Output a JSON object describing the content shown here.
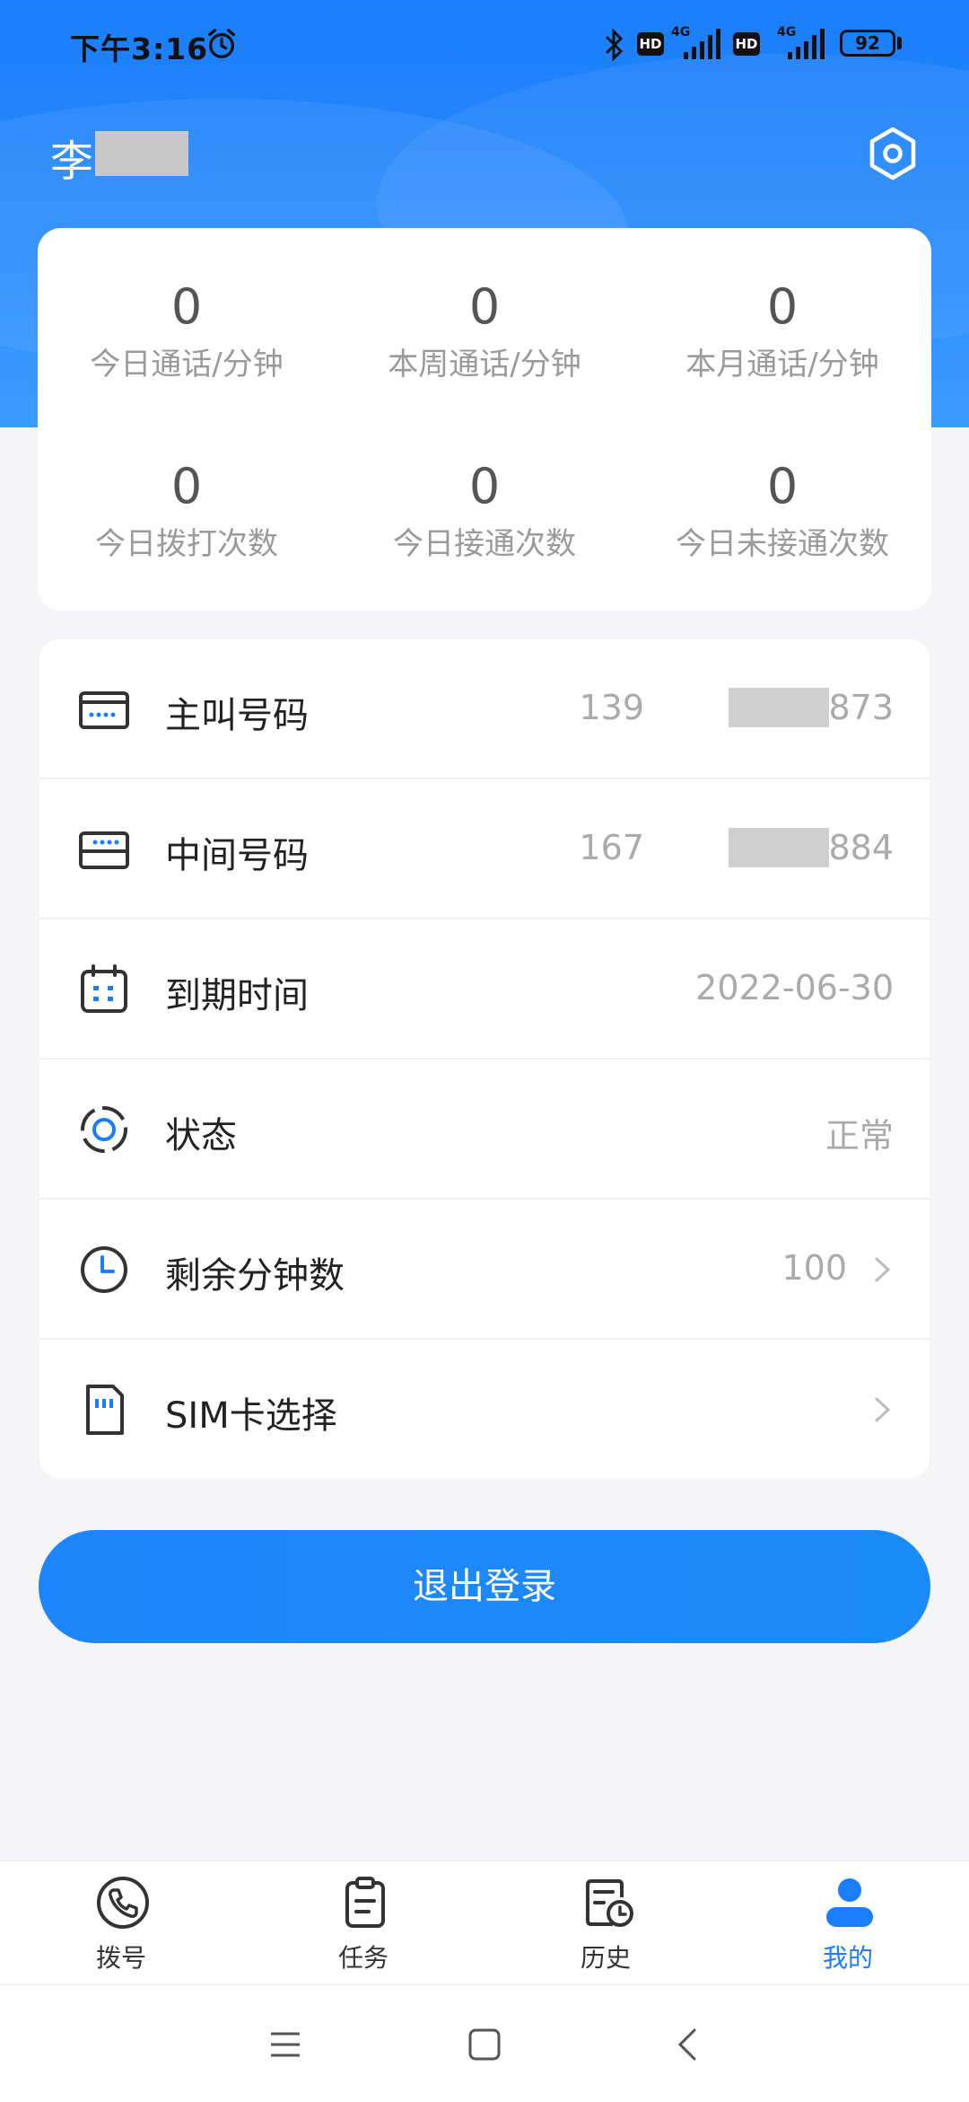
{
  "status_bar": {
    "time": "下午3:16",
    "sim1_network": "4G",
    "sim2_network": "4G",
    "hd_label": "HD",
    "battery": "92"
  },
  "header": {
    "user_name_visible": "李",
    "settings_icon": "settings-hexagon-icon"
  },
  "stats": [
    {
      "value": "0",
      "label": "今日通话/分钟"
    },
    {
      "value": "0",
      "label": "本周通话/分钟"
    },
    {
      "value": "0",
      "label": "本月通话/分钟"
    },
    {
      "value": "0",
      "label": "今日拨打次数"
    },
    {
      "value": "0",
      "label": "今日接通次数"
    },
    {
      "value": "0",
      "label": "今日未接通次数"
    }
  ],
  "menu": {
    "caller_number": {
      "label": "主叫号码",
      "prefix": "139",
      "suffix": "873",
      "icon": "phone-number-card-icon"
    },
    "middle_number": {
      "label": "中间号码",
      "prefix": "167",
      "suffix": "884",
      "icon": "relay-number-card-icon"
    },
    "expiry": {
      "label": "到期时间",
      "value": "2022-06-30",
      "icon": "calendar-icon"
    },
    "status": {
      "label": "状态",
      "value": "正常",
      "icon": "status-ring-icon"
    },
    "remaining_minutes": {
      "label": "剩余分钟数",
      "value": "100",
      "icon": "clock-icon"
    },
    "sim_select": {
      "label": "SIM卡选择",
      "value": "",
      "icon": "sim-card-icon"
    }
  },
  "logout_label": "退出登录",
  "tabs": [
    {
      "label": "拨号",
      "icon": "phone-icon"
    },
    {
      "label": "任务",
      "icon": "clipboard-icon"
    },
    {
      "label": "历史",
      "icon": "history-icon"
    },
    {
      "label": "我的",
      "icon": "user-icon",
      "active": true
    }
  ],
  "colors": {
    "primary": "#1a7dfb",
    "muted_text": "#9a9a9a",
    "background": "#f5f5f7"
  }
}
